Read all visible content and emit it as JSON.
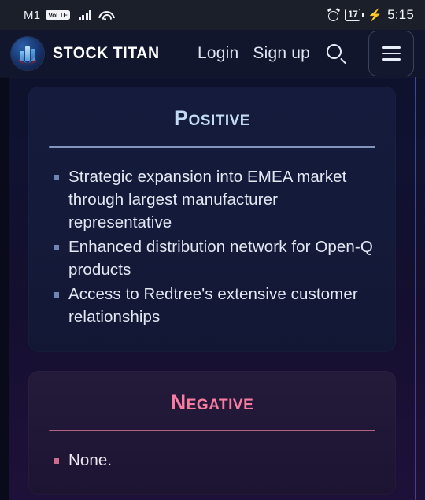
{
  "statusbar": {
    "carrier": "M1",
    "network_badge": "VoLTE",
    "signal_icon": "signal-bars-icon",
    "wifi_icon": "wifi-icon",
    "alarm_icon": "alarm-clock-icon",
    "battery_level": "17",
    "charging_icon": "lightning-bolt-icon",
    "time": "5:15"
  },
  "header": {
    "logo_icon": "stock-titan-logo-icon",
    "brand": "STOCK TITAN",
    "login_label": "Login",
    "signup_label": "Sign up",
    "search_icon": "search-icon",
    "menu_icon": "hamburger-menu-icon"
  },
  "content": {
    "cards": [
      {
        "id": "positive",
        "title": "Positive",
        "accent": "#c3dbf5",
        "points": [
          "Strategic expansion into EMEA market through largest manufacturer representative",
          "Enhanced distribution network for Open-Q products",
          "Access to Redtree's extensive customer relationships"
        ]
      },
      {
        "id": "negative",
        "title": "Negative",
        "accent": "#f87ba2",
        "points": [
          "None."
        ]
      }
    ]
  }
}
